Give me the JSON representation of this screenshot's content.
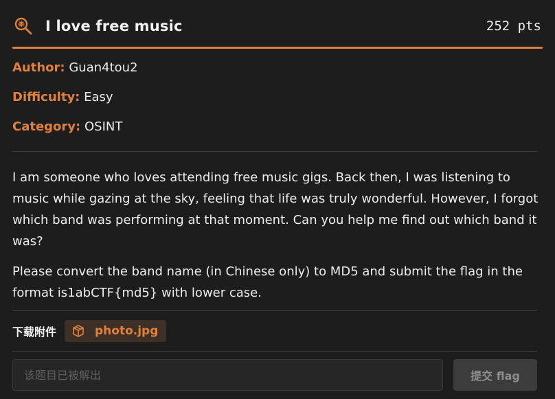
{
  "challenge": {
    "title": "I love free music",
    "points": "252 pts",
    "search_icon": "magnifier-icon",
    "accent_color": "#e0803e"
  },
  "meta": {
    "author_key": "Author:",
    "author_val": "Guan4tou2",
    "difficulty_key": "Difficulty:",
    "difficulty_val": "Easy",
    "category_key": "Category:",
    "category_val": "OSINT"
  },
  "description": {
    "p1": "I am someone who loves attending free music gigs. Back then, I was listening to music while gazing at the sky, feeling that life was truly wonderful. However, I forgot which band was performing at that moment. Can you help me find out which band it was?",
    "p2": "Please convert the band name (in Chinese only) to MD5 and submit the flag in the format is1abCTF{md5} with lower case."
  },
  "attachment": {
    "label": "下载附件",
    "file_icon": "package-icon",
    "file_name": "photo.jpg"
  },
  "submit": {
    "placeholder": "该题目已被解出",
    "button_label": "提交 flag"
  }
}
